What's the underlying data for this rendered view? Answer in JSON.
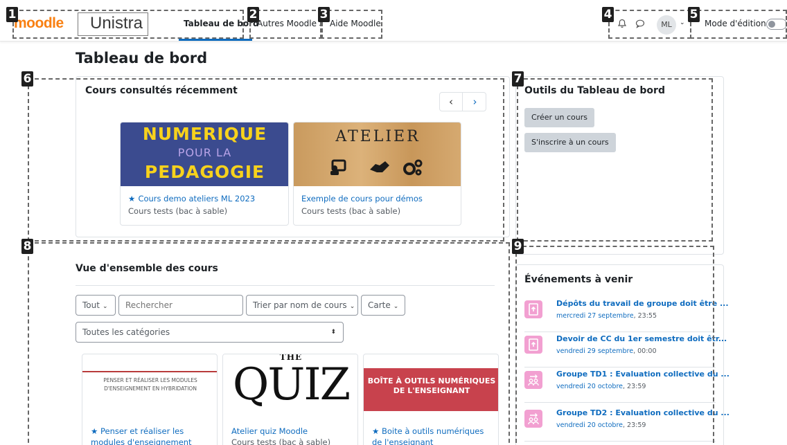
{
  "navbar": {
    "logo_text": "moodle",
    "institution": "Unistra",
    "links": [
      {
        "label": "Tableau de bord",
        "active": true
      },
      {
        "label": "Autres Moodle",
        "dropdown": true
      },
      {
        "label": "Aide Moodle"
      }
    ],
    "notifications_icon": "bell-icon",
    "messages_icon": "chat-bubble-icon",
    "avatar_initials": "ML",
    "edit_mode_label": "Mode d'édition",
    "edit_mode_on": false
  },
  "page_title": "Tableau de bord",
  "recent_courses": {
    "title": "Cours consultés récemment",
    "courses": [
      {
        "image_lines": [
          "NUMERIQUE",
          "POUR LA",
          "PEDAGOGIE"
        ],
        "name": "Cours demo ateliers ML 2023",
        "category": "Cours tests (bac à sable)",
        "starred": true
      },
      {
        "image_lines": [
          "ATELIER"
        ],
        "name": "Exemple de cours pour démos",
        "category": "Cours tests (bac à sable)",
        "starred": false
      }
    ]
  },
  "tools": {
    "title": "Outils du Tableau de bord",
    "buttons": [
      "Créer un cours",
      "S'inscrire à un cours"
    ]
  },
  "overview": {
    "title": "Vue d'ensemble des cours",
    "filter_label": "Tout",
    "search_placeholder": "Rechercher",
    "sort_label": "Trier par nom de cours",
    "view_label": "Carte",
    "category_select": "Toutes les catégories",
    "courses": [
      {
        "image_text": "PENSER ET RÉALISER LES MODULES D'ENSEIGNEMENT EN HYBRIDATION",
        "name": "Penser et réaliser les modules d'enseignement",
        "category": "",
        "starred": true
      },
      {
        "image_text_top": "THE",
        "image_text": "QUIZ",
        "name": "Atelier quiz Moodle",
        "category": "Cours tests (bac à sable)",
        "starred": false
      },
      {
        "image_text": "BOÎTE À OUTILS NUMÉRIQUES DE L'ENSEIGNANT",
        "name": "Boite à outils numériques de l'enseignant",
        "category": "",
        "starred": true
      }
    ]
  },
  "events": {
    "title": "Événements à venir",
    "items": [
      {
        "title": "Dépôts du travail de groupe doit être ...",
        "date": "mercredi 27 septembre",
        "time": ", 23:55",
        "icon": "assignment-icon"
      },
      {
        "title": "Devoir de CC du 1er semestre doit êtr...",
        "date": "vendredi 29 septembre",
        "time": ", 00:00",
        "icon": "assignment-icon"
      },
      {
        "title": "Groupe TD1 : Evaluation collective du ...",
        "date": "vendredi 20 octobre",
        "time": ", 23:59",
        "icon": "workshop-icon"
      },
      {
        "title": "Groupe TD2 : Evaluation collective du ...",
        "date": "vendredi 20 octobre",
        "time": ", 23:59",
        "icon": "workshop-icon"
      }
    ]
  },
  "annotations": [
    "1",
    "2",
    "3",
    "4",
    "5",
    "6",
    "7",
    "8",
    "9"
  ]
}
